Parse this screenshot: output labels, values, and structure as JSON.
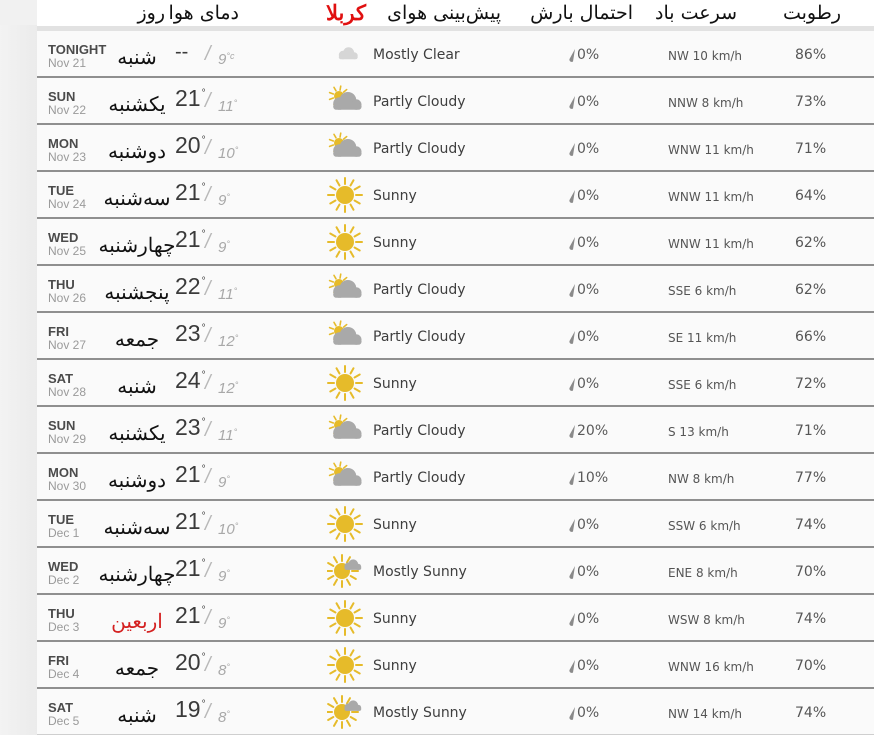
{
  "header": {
    "humidity": "رطوبت",
    "wind_speed": "سرعت باد",
    "precip_chance": "احتمال بارش",
    "forecast_prefix": "پیش‌بینی هوای",
    "city": "کربلا",
    "temperature": "دمای هوا",
    "day": "روز"
  },
  "colors": {
    "city_highlight": "#e01010",
    "holiday": "#d42020",
    "sun": "#e6bb2a",
    "cloud": "#a9a9a9",
    "moon": "#bdbdbd"
  },
  "forecast": [
    {
      "day": "TONIGHT",
      "date": "Nov 21",
      "persian": "شنبه",
      "hi": "--",
      "lo": "9",
      "lo_unit": "°c",
      "icon": "moon-cloud-icon",
      "condition": "Mostly Clear",
      "precip": "0%",
      "wind": "NW 10 km/h",
      "humidity": "86%",
      "holiday": false
    },
    {
      "day": "SUN",
      "date": "Nov 22",
      "persian": "یکشنبه",
      "hi": "21",
      "lo": "11",
      "icon": "partly-cloudy-icon",
      "condition": "Partly Cloudy",
      "precip": "0%",
      "wind": "NNW 8 km/h",
      "humidity": "73%",
      "holiday": false
    },
    {
      "day": "MON",
      "date": "Nov 23",
      "persian": "دوشنبه",
      "hi": "20",
      "lo": "10",
      "icon": "partly-cloudy-icon",
      "condition": "Partly Cloudy",
      "precip": "0%",
      "wind": "WNW 11 km/h",
      "humidity": "71%",
      "holiday": false
    },
    {
      "day": "TUE",
      "date": "Nov 24",
      "persian": "سه‌شنبه",
      "hi": "21",
      "lo": "9",
      "icon": "sun-icon",
      "condition": "Sunny",
      "precip": "0%",
      "wind": "WNW 11 km/h",
      "humidity": "64%",
      "holiday": false
    },
    {
      "day": "WED",
      "date": "Nov 25",
      "persian": "چهارشنبه",
      "hi": "21",
      "lo": "9",
      "icon": "sun-icon",
      "condition": "Sunny",
      "precip": "0%",
      "wind": "WNW 11 km/h",
      "humidity": "62%",
      "holiday": false
    },
    {
      "day": "THU",
      "date": "Nov 26",
      "persian": "پنجشنبه",
      "hi": "22",
      "lo": "11",
      "icon": "partly-cloudy-icon",
      "condition": "Partly Cloudy",
      "precip": "0%",
      "wind": "SSE 6 km/h",
      "humidity": "62%",
      "holiday": false
    },
    {
      "day": "FRI",
      "date": "Nov 27",
      "persian": "جمعه",
      "hi": "23",
      "lo": "12",
      "icon": "partly-cloudy-icon",
      "condition": "Partly Cloudy",
      "precip": "0%",
      "wind": "SE 11 km/h",
      "humidity": "66%",
      "holiday": false
    },
    {
      "day": "SAT",
      "date": "Nov 28",
      "persian": "شنبه",
      "hi": "24",
      "lo": "12",
      "icon": "sun-icon",
      "condition": "Sunny",
      "precip": "0%",
      "wind": "SSE 6 km/h",
      "humidity": "72%",
      "holiday": false
    },
    {
      "day": "SUN",
      "date": "Nov 29",
      "persian": "یکشنبه",
      "hi": "23",
      "lo": "11",
      "icon": "partly-cloudy-icon",
      "condition": "Partly Cloudy",
      "precip": "20%",
      "wind": "S 13 km/h",
      "humidity": "71%",
      "holiday": false
    },
    {
      "day": "MON",
      "date": "Nov 30",
      "persian": "دوشنبه",
      "hi": "21",
      "lo": "9",
      "icon": "partly-cloudy-icon",
      "condition": "Partly Cloudy",
      "precip": "10%",
      "wind": "NW 8 km/h",
      "humidity": "77%",
      "holiday": false
    },
    {
      "day": "TUE",
      "date": "Dec 1",
      "persian": "سه‌شنبه",
      "hi": "21",
      "lo": "10",
      "icon": "sun-icon",
      "condition": "Sunny",
      "precip": "0%",
      "wind": "SSW 6 km/h",
      "humidity": "74%",
      "holiday": false
    },
    {
      "day": "WED",
      "date": "Dec 2",
      "persian": "چهارشنبه",
      "hi": "21",
      "lo": "9",
      "icon": "mostly-sunny-icon",
      "condition": "Mostly Sunny",
      "precip": "0%",
      "wind": "ENE 8 km/h",
      "humidity": "70%",
      "holiday": false
    },
    {
      "day": "THU",
      "date": "Dec 3",
      "persian": "اربعین",
      "hi": "21",
      "lo": "9",
      "icon": "sun-icon",
      "condition": "Sunny",
      "precip": "0%",
      "wind": "WSW 8 km/h",
      "humidity": "74%",
      "holiday": true
    },
    {
      "day": "FRI",
      "date": "Dec 4",
      "persian": "جمعه",
      "hi": "20",
      "lo": "8",
      "icon": "sun-icon",
      "condition": "Sunny",
      "precip": "0%",
      "wind": "WNW 16 km/h",
      "humidity": "70%",
      "holiday": false
    },
    {
      "day": "SAT",
      "date": "Dec 5",
      "persian": "شنبه",
      "hi": "19",
      "lo": "8",
      "icon": "mostly-sunny-icon",
      "condition": "Mostly Sunny",
      "precip": "0%",
      "wind": "NW 14 km/h",
      "humidity": "74%",
      "holiday": false
    }
  ]
}
